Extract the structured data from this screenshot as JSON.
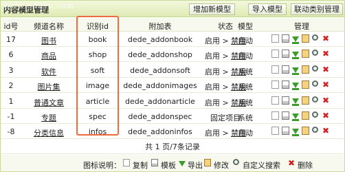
{
  "header": {
    "title": "内容模型管理",
    "watermark": "www.eduyo.com",
    "buttons": [
      "增加新模型",
      "导入模型",
      "联动类别管理"
    ]
  },
  "table": {
    "columns": [
      "id号",
      "频道名称",
      "识别id",
      "附加表",
      "状态",
      "模型",
      "管理"
    ],
    "rows": [
      {
        "id": "17",
        "name": "图书",
        "ident": "book",
        "addon": "dede_addonbook",
        "status_on": "启用 >",
        "status_off": "禁用",
        "model": "自动"
      },
      {
        "id": "6",
        "name": "商品",
        "ident": "shop",
        "addon": "dede_addonshop",
        "status_on": "启用 >",
        "status_off": "禁用",
        "model": "自动"
      },
      {
        "id": "3",
        "name": "软件",
        "ident": "soft",
        "addon": "dede_addonsoft",
        "status_on": "启用 >",
        "status_off": "禁用",
        "model": "系统"
      },
      {
        "id": "2",
        "name": "图片集",
        "ident": "image",
        "addon": "dede_addonimages",
        "status_on": "启用 >",
        "status_off": "禁用",
        "model": "系统"
      },
      {
        "id": "1",
        "name": "普通文章",
        "ident": "article",
        "addon": "dede_addonarticle",
        "status_on": "启用 >",
        "status_off": "禁用",
        "model": "系统"
      },
      {
        "id": "-1",
        "name": "专题",
        "ident": "spec",
        "addon": "dede_addonspec",
        "status_on": "固定项目",
        "status_off": "",
        "model": "系统"
      },
      {
        "id": "-8",
        "name": "分类信息",
        "ident": "infos",
        "addon": "dede_addoninfos",
        "status_on": "启用 >",
        "status_off": "禁用",
        "model": "自动"
      }
    ]
  },
  "pager": {
    "text": "共 1 页/7条记录"
  },
  "legend": {
    "label": "图标说明：",
    "items": [
      "复制",
      "模板",
      "导出",
      "修改",
      "自定义搜索",
      "删除"
    ]
  },
  "icons": [
    "copy-icon",
    "template-icon",
    "export-icon",
    "edit-icon",
    "search-icon",
    "delete-icon"
  ],
  "colors": {
    "highlight": "#ef6a3d",
    "header_bg": "#dfeab4",
    "delete": "#d42020",
    "export": "#3a9d2a"
  }
}
